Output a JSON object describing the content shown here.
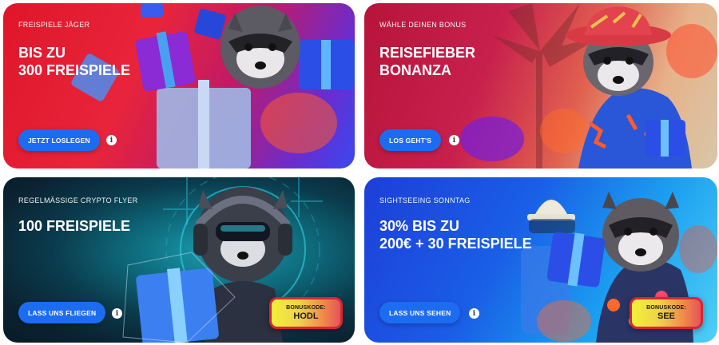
{
  "cards": [
    {
      "eyebrow": "FREISPIELE JÄGER",
      "title_lines": [
        "BIS ZU",
        "300 FREISPIELE"
      ],
      "cta": "JETZT LOSLEGEN",
      "info": "i"
    },
    {
      "eyebrow": "WÄHLE DEINEN BONUS",
      "title_lines": [
        "REISEFIEBER",
        "BONANZA"
      ],
      "cta": "LOS GEHT'S",
      "info": "i"
    },
    {
      "eyebrow": "REGELMÄSSIGE CRYPTO FLYER",
      "title_lines": [
        "100 FREISPIELE"
      ],
      "cta": "LASS UNS FLIEGEN",
      "info": "i",
      "bonus": {
        "label": "BONUSKODE:",
        "code": "HODL"
      }
    },
    {
      "eyebrow": "SIGHTSEEING SONNTAG",
      "title_lines": [
        "30% BIS ZU",
        "200€ + 30 FREISPIELE"
      ],
      "cta": "LASS UNS SEHEN",
      "info": "i",
      "bonus": {
        "label": "BONUSKODE:",
        "code": "SEE"
      }
    }
  ]
}
